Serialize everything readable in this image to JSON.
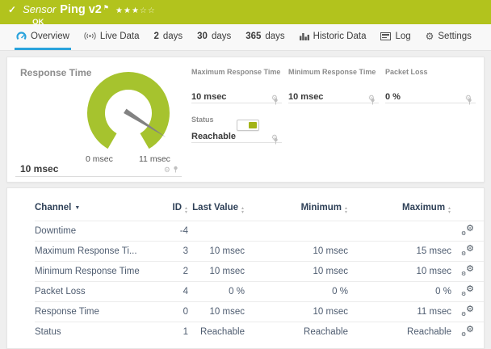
{
  "header": {
    "kind_label": "Sensor",
    "title": "Ping v2",
    "status_text": "OK",
    "rating": {
      "filled": 3,
      "total": 5
    }
  },
  "tabs": [
    {
      "label": "Overview",
      "icon": "gauge-icon",
      "active": true
    },
    {
      "label": "Live Data",
      "icon": "live-data-icon"
    },
    {
      "num": "2",
      "label": "days"
    },
    {
      "num": "30",
      "label": "days"
    },
    {
      "num": "365",
      "label": "days"
    },
    {
      "label": "Historic Data",
      "icon": "bar-chart-icon"
    },
    {
      "label": "Log",
      "icon": "log-icon"
    },
    {
      "label": "Settings",
      "icon": "gear-icon"
    }
  ],
  "gauges": {
    "main": {
      "label": "Response Time",
      "value_label": "10 msec",
      "value": 10,
      "min": 0,
      "max": 11,
      "min_tick": "0 msec",
      "max_tick": "11 msec"
    },
    "small": [
      {
        "label": "Maximum Response Time",
        "value_label": "10 msec",
        "value": 10,
        "min": 0,
        "max": 15
      },
      {
        "label": "Minimum Response Time",
        "value_label": "10 msec",
        "value": 10,
        "min": 0,
        "max": 10
      },
      {
        "label": "Packet Loss",
        "value_label": "0 %",
        "value": 0,
        "min": 0,
        "max": 100
      }
    ],
    "status_tile": {
      "label": "Status",
      "value_label": "Reachable",
      "indicator": "on"
    }
  },
  "table": {
    "columns": {
      "channel": "Channel",
      "id": "ID",
      "last": "Last Value",
      "min": "Minimum",
      "max": "Maximum"
    },
    "rows": [
      {
        "channel": "Downtime",
        "id": "-4",
        "last": "",
        "min": "",
        "max": ""
      },
      {
        "channel": "Maximum Response Ti...",
        "id": "3",
        "last": "10 msec",
        "min": "10 msec",
        "max": "15 msec"
      },
      {
        "channel": "Minimum Response Time",
        "id": "2",
        "last": "10 msec",
        "min": "10 msec",
        "max": "10 msec"
      },
      {
        "channel": "Packet Loss",
        "id": "4",
        "last": "0 %",
        "min": "0 %",
        "max": "0 %"
      },
      {
        "channel": "Response Time",
        "id": "0",
        "last": "10 msec",
        "min": "10 msec",
        "max": "11 msec"
      },
      {
        "channel": "Status",
        "id": "1",
        "last": "Reachable",
        "min": "Reachable",
        "max": "Reachable"
      }
    ]
  },
  "colors": {
    "header_bar": "#b2c31d",
    "gauge_green": "#a6c32e",
    "accent_blue": "#2aa3dc",
    "status_ok_green": "#a3b417"
  }
}
